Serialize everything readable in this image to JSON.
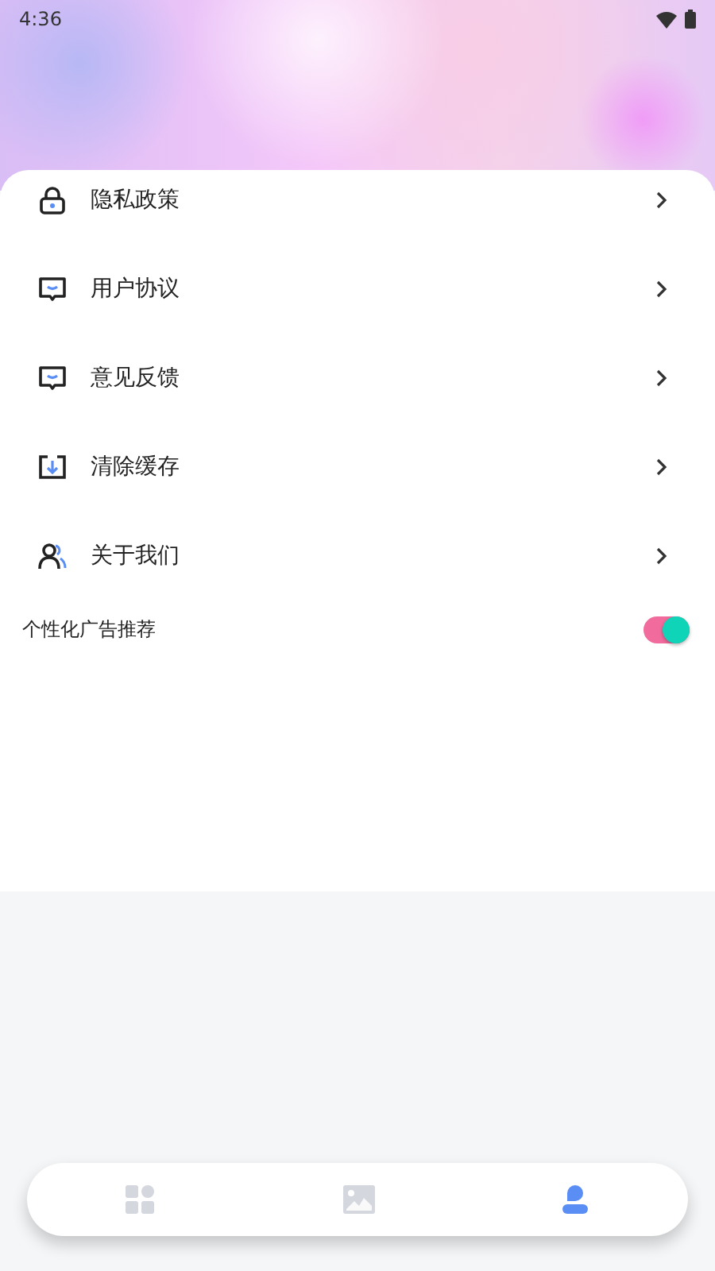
{
  "status_bar": {
    "time": "4:36"
  },
  "menu": [
    {
      "kind": "lock",
      "label": "隐私政策"
    },
    {
      "kind": "message",
      "label": "用户协议"
    },
    {
      "kind": "message",
      "label": "意见反馈"
    },
    {
      "kind": "download",
      "label": "清除缓存"
    },
    {
      "kind": "people",
      "label": "关于我们"
    }
  ],
  "ad_setting": {
    "label": "个性化广告推荐",
    "on": true
  },
  "bottom_nav": [
    {
      "kind": "grid",
      "selected": false
    },
    {
      "kind": "image",
      "selected": false
    },
    {
      "kind": "person",
      "selected": true
    }
  ]
}
